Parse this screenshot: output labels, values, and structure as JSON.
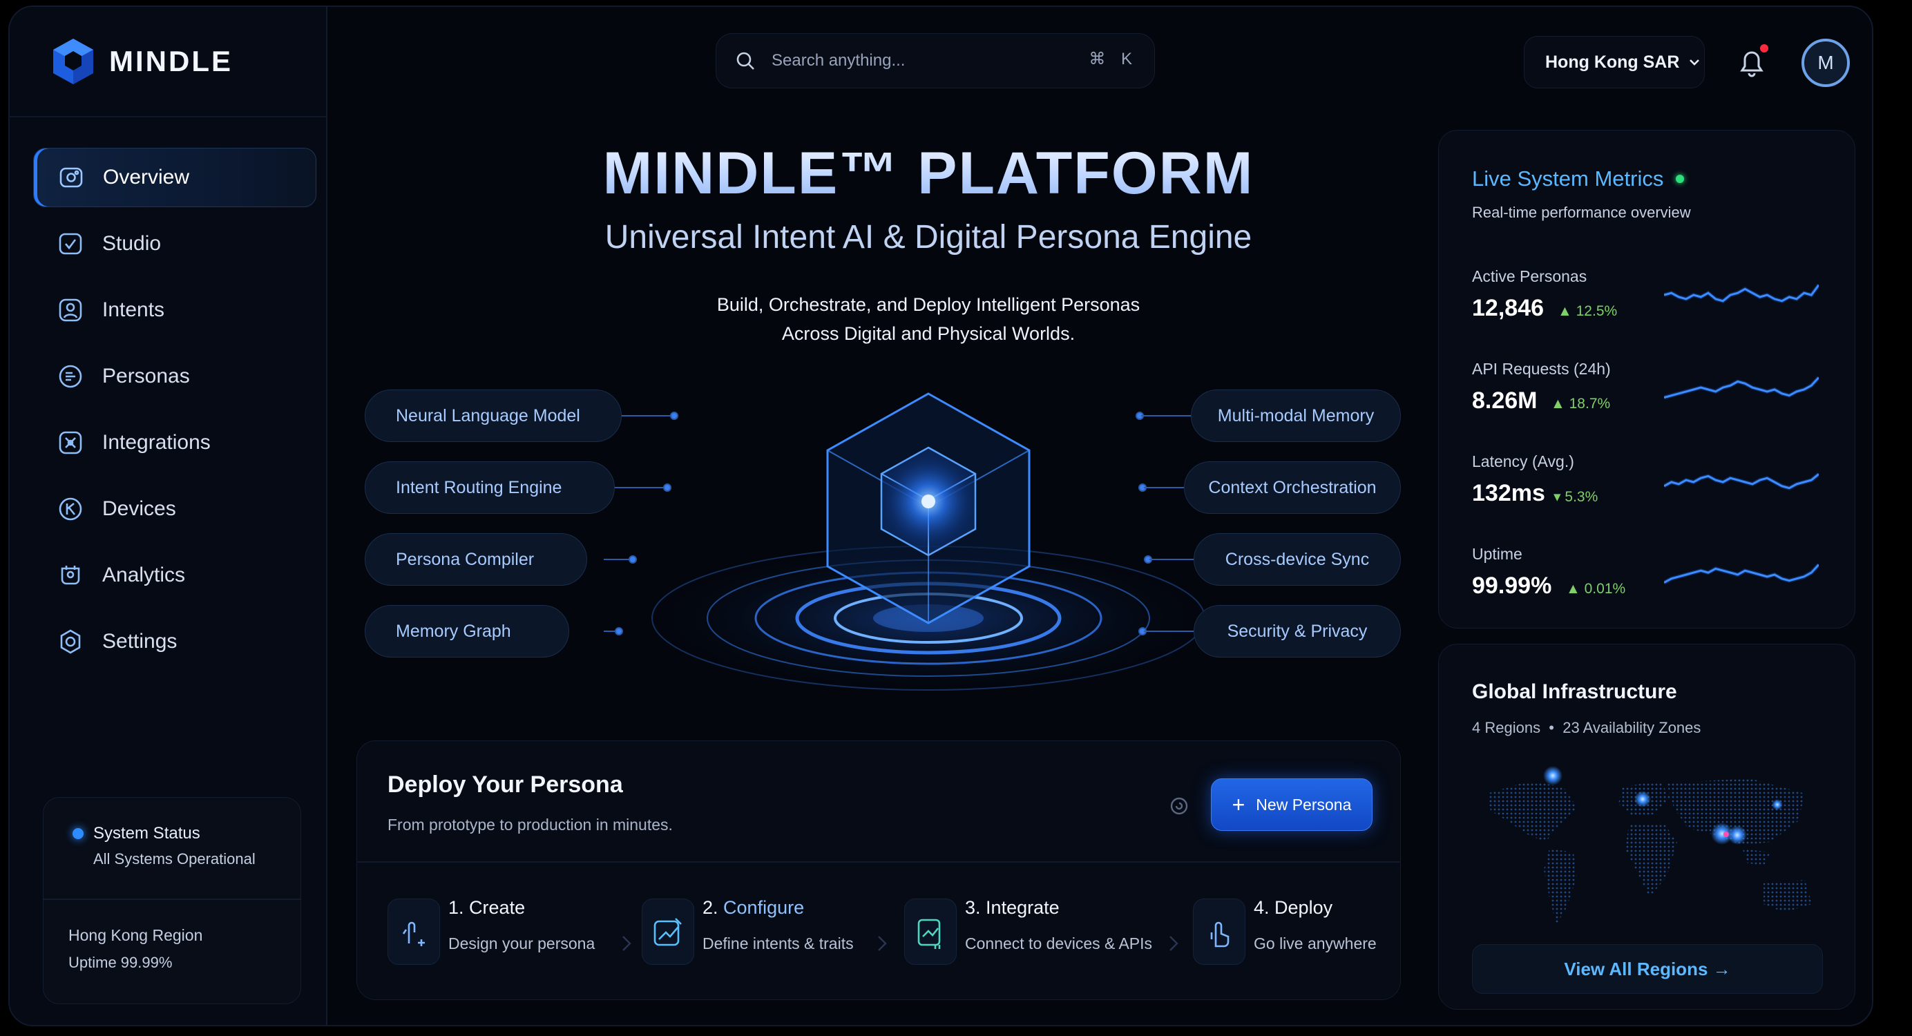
{
  "app": {
    "brand": "MINDLE"
  },
  "sidebar": {
    "items": [
      {
        "label": "Overview",
        "icon": "overview-icon",
        "active": true
      },
      {
        "label": "Studio",
        "icon": "studio-icon"
      },
      {
        "label": "Intents",
        "icon": "intents-icon"
      },
      {
        "label": "Personas",
        "icon": "personas-icon"
      },
      {
        "label": "Integrations",
        "icon": "integrations-icon"
      },
      {
        "label": "Devices",
        "icon": "devices-icon"
      },
      {
        "label": "Analytics",
        "icon": "analytics-icon"
      },
      {
        "label": "Settings",
        "icon": "gear-icon"
      }
    ],
    "status": {
      "title": "System Status",
      "message": "All Systems Operational",
      "region": "Hong Kong Region",
      "uptime": "Uptime 99.99%"
    }
  },
  "topbar": {
    "search_placeholder": "Search anything...",
    "shortcut": "⌘ K",
    "region": "Hong Kong SAR",
    "avatar_initial": "M",
    "has_notification": true
  },
  "hero": {
    "title": "MINDLE™ PLATFORM",
    "subtitle": "Universal Intent AI & Digital Persona Engine",
    "desc_line1": "Build, Orchestrate, and Deploy Intelligent Personas",
    "desc_line2": "Across Digital and Physical Worlds.",
    "left_features": [
      "Neural Language Model",
      "Intent Routing Engine",
      "Persona Compiler",
      "Memory Graph"
    ],
    "right_features": [
      "Multi-modal Memory",
      "Context Orchestration",
      "Cross-device Sync",
      "Security & Privacy"
    ]
  },
  "deploy": {
    "title": "Deploy Your Persona",
    "subtitle": "From prototype to production in minutes.",
    "new_button": "New Persona",
    "steps": [
      {
        "num": "1.",
        "title": "Create",
        "desc": "Design your persona"
      },
      {
        "num": "2.",
        "title": "Configure",
        "desc": "Define intents & traits"
      },
      {
        "num": "3.",
        "title": "Integrate",
        "desc": "Connect to devices & APIs"
      },
      {
        "num": "4.",
        "title": "Deploy",
        "desc": "Go live anywhere"
      }
    ]
  },
  "metrics": {
    "title": "Live System Metrics",
    "subtitle": "Real-time performance overview",
    "items": [
      {
        "label": "Active Personas",
        "value": "12,846",
        "delta": "12.5%",
        "trend": [
          0.55,
          0.6,
          0.5,
          0.45,
          0.55,
          0.5,
          0.6,
          0.45,
          0.4,
          0.55,
          0.6,
          0.7,
          0.6,
          0.5,
          0.55,
          0.45,
          0.4,
          0.5,
          0.45,
          0.6,
          0.55,
          0.8
        ]
      },
      {
        "label": "API Requests (24h)",
        "value": "8.26M",
        "delta": "18.7%",
        "trend": [
          0.3,
          0.35,
          0.4,
          0.45,
          0.5,
          0.55,
          0.5,
          0.45,
          0.55,
          0.6,
          0.7,
          0.65,
          0.55,
          0.5,
          0.45,
          0.5,
          0.4,
          0.35,
          0.45,
          0.5,
          0.6,
          0.8
        ]
      },
      {
        "label": "Latency (Avg.)",
        "value": "132ms",
        "delta": "5.3%",
        "trend": [
          0.4,
          0.5,
          0.45,
          0.55,
          0.5,
          0.6,
          0.65,
          0.55,
          0.5,
          0.6,
          0.55,
          0.5,
          0.45,
          0.55,
          0.6,
          0.5,
          0.4,
          0.35,
          0.45,
          0.5,
          0.55,
          0.7
        ]
      },
      {
        "label": "Uptime",
        "value": "99.99%",
        "delta": "0.01%",
        "trend": [
          0.3,
          0.4,
          0.45,
          0.5,
          0.55,
          0.6,
          0.55,
          0.65,
          0.6,
          0.55,
          0.5,
          0.6,
          0.55,
          0.5,
          0.45,
          0.5,
          0.4,
          0.35,
          0.4,
          0.45,
          0.55,
          0.75
        ]
      }
    ]
  },
  "infra": {
    "title": "Global Infrastructure",
    "regions": "4 Regions",
    "zones": "23 Availability Zones",
    "button": "View All Regions →"
  },
  "colors": {
    "accent": "#2e7bff",
    "accent_light": "#5cb8ff",
    "positive": "#7fcf6a",
    "live": "#2ee07a",
    "notification": "#ff2a3d"
  }
}
